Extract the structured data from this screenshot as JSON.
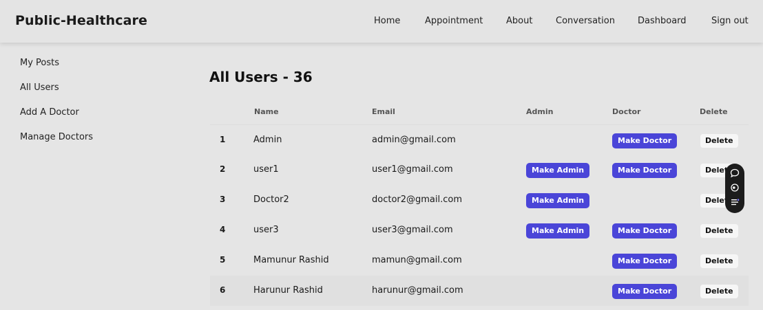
{
  "navbar": {
    "brand": "Public-Healthcare",
    "links": [
      "Home",
      "Appointment",
      "About",
      "Conversation",
      "Dashboard",
      "Sign out"
    ]
  },
  "sidebar": {
    "items": [
      "My Posts",
      "All Users",
      "Add A Doctor",
      "Manage Doctors"
    ]
  },
  "main": {
    "title": "All Users - 36",
    "table": {
      "headers": [
        "Name",
        "Email",
        "Admin",
        "Doctor",
        "Delete"
      ],
      "make_admin_label": "Make Admin",
      "make_doctor_label": "Make Doctor",
      "delete_label": "Delete",
      "rows": [
        {
          "num": "1",
          "name": "Admin",
          "email": "admin@gmail.com"
        },
        {
          "num": "2",
          "name": "user1",
          "email": "user1@gmail.com"
        },
        {
          "num": "3",
          "name": "Doctor2",
          "email": "doctor2@gmail.com"
        },
        {
          "num": "4",
          "name": "user3",
          "email": "user3@gmail.com"
        },
        {
          "num": "5",
          "name": "Mamunur Rashid",
          "email": "mamun@gmail.com"
        },
        {
          "num": "6",
          "name": "Harunur Rashid",
          "email": "harunur@gmail.com"
        }
      ]
    }
  },
  "floating_toolbar": {
    "icons": [
      "chat-bubble-icon",
      "eye-icon",
      "list-icon"
    ]
  },
  "colors": {
    "background": "#e5e5e5",
    "button_primary": "#4a45d8",
    "button_secondary": "#f6f6f6",
    "toolbar": "#1c1c1c"
  }
}
